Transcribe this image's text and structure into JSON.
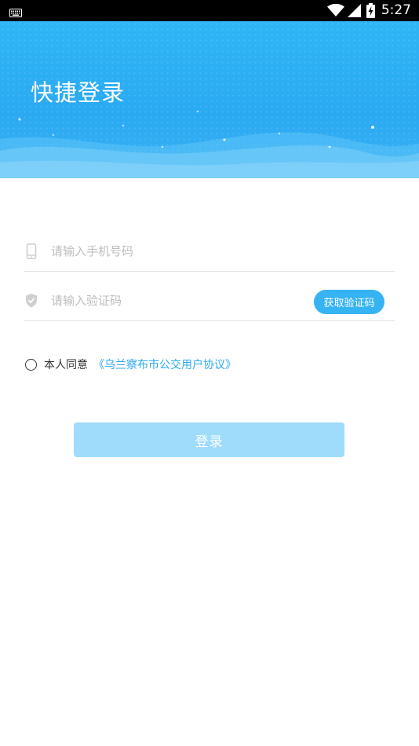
{
  "status_bar": {
    "time": "5:27",
    "icons": [
      "keyboard-icon",
      "wifi-icon",
      "signal-icon",
      "battery-charging-icon"
    ]
  },
  "header": {
    "title": "快捷登录"
  },
  "form": {
    "phone": {
      "value": "",
      "placeholder": "请输入手机号码",
      "icon": "phone-icon"
    },
    "code": {
      "value": "",
      "placeholder": "请输入验证码",
      "icon": "shield-check-icon",
      "get_code_label": "获取验证码"
    }
  },
  "agreement": {
    "checked": false,
    "text": "本人同意",
    "link_text": "《乌兰察布市公交用户协议》"
  },
  "login": {
    "label": "登录"
  },
  "colors": {
    "accent": "#35b3f3",
    "link": "#2ea8ef",
    "login_disabled": "#9fdcfb"
  }
}
